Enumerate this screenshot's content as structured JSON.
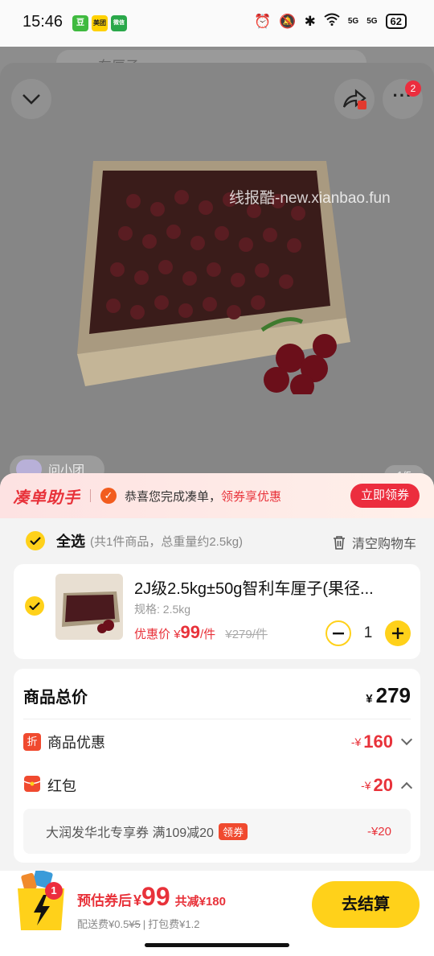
{
  "status_bar": {
    "time": "15:46",
    "app_badges": [
      "豆",
      "美团",
      "微信"
    ],
    "signal_labels": [
      "5G",
      "5G"
    ],
    "battery": "62"
  },
  "background": {
    "search_placeholder": "车厘子"
  },
  "image_viewer": {
    "watermark": "线报酷-new.xianbao.fun",
    "cart_badge_count": "2",
    "ask_label": "问小团",
    "page_indicator": "1/5"
  },
  "promo": {
    "title": "凑单助手",
    "message": "恭喜您完成凑单，",
    "highlight": "领券享优惠",
    "claim_label": "立即领券"
  },
  "select_all": {
    "label": "全选",
    "note": "(共1件商品，总重量约2.5kg)",
    "clear_label": "清空购物车"
  },
  "product": {
    "name": "2J级2.5kg±50g智利车厘子(果径...",
    "spec": "规格: 2.5kg",
    "price_label": "优惠价",
    "price_yen": "¥",
    "price_value": "99",
    "price_unit": "/件",
    "old_price": "¥279/件",
    "quantity": "1"
  },
  "summary": {
    "total_label": "商品总价",
    "total_yen": "¥",
    "total_value": "279",
    "discount_icon": "折",
    "discount_label": "商品优惠",
    "discount_prefix": "-¥",
    "discount_value": "160",
    "redpacket_label": "红包",
    "redpacket_prefix": "-¥",
    "redpacket_value": "20",
    "coupon_name": "大润发华北专享券  满109减20",
    "coupon_tag": "领券",
    "coupon_amount": "-¥20"
  },
  "footer": {
    "cart_badge": "1",
    "est_label": "预估券后",
    "est_yen": "¥",
    "est_amount": "99",
    "save_text": "共减¥180",
    "delivery_fee": "配送费¥0.5",
    "delivery_fee_old": "¥5",
    "packing_fee": "打包费¥1.2",
    "checkout_label": "去结算"
  },
  "colors": {
    "accent_yellow": "#ffd11a",
    "accent_red": "#e8323a"
  }
}
